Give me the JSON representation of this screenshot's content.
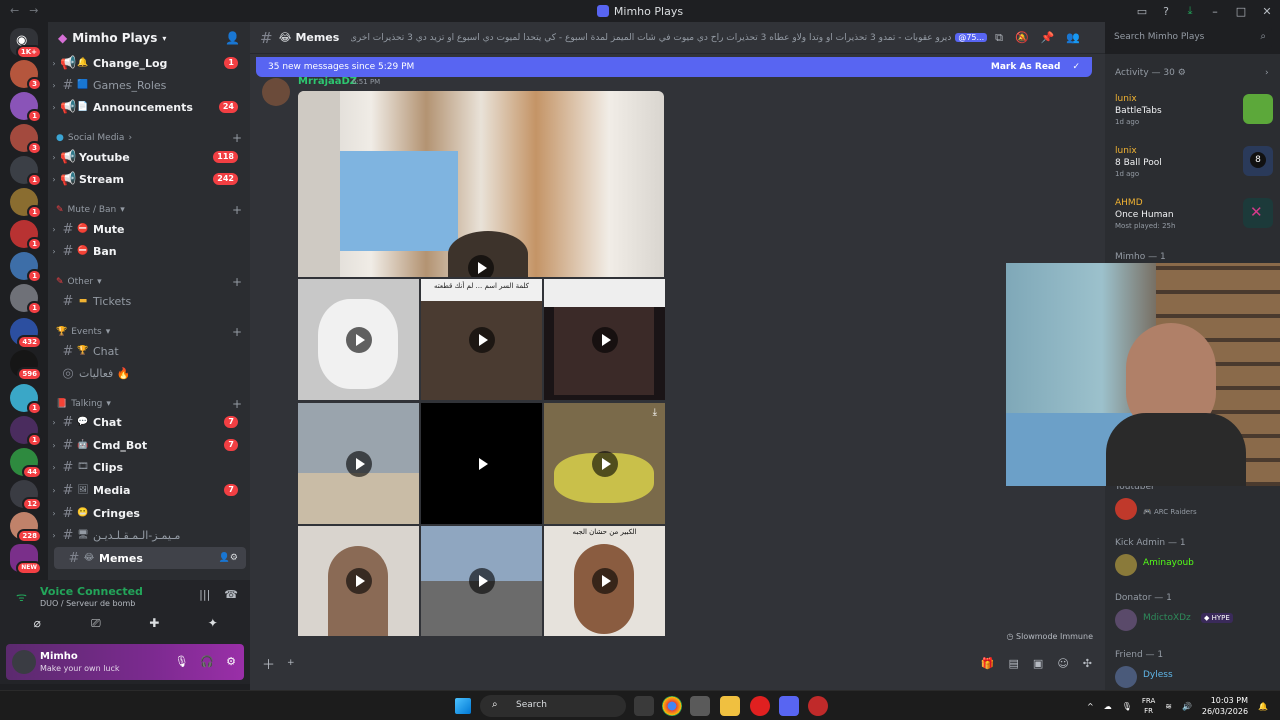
{
  "window": {
    "title": "Mimho Plays"
  },
  "server": {
    "name": "Mimho Plays",
    "channels_top": [
      {
        "name": "Change_Log",
        "emoji": "🔔",
        "count": "1",
        "bold": true
      },
      {
        "name": "Games_Roles",
        "emoji": "🟦",
        "count": "",
        "bold": false
      },
      {
        "name": "Announcements",
        "emoji": "📄",
        "count": "24",
        "bold": true
      }
    ],
    "categories": {
      "social": "Social Media",
      "mute": "Mute / Ban",
      "other": "Other",
      "events": "Events",
      "talking": "Talking"
    },
    "social_channels": [
      {
        "name": "Youtube",
        "count": "118"
      },
      {
        "name": "Stream",
        "count": "242"
      }
    ],
    "mute_channels": [
      {
        "name": "Mute"
      },
      {
        "name": "Ban"
      }
    ],
    "other_channels": [
      {
        "name": "Tickets"
      }
    ],
    "event_channels": [
      {
        "name": "Chat"
      },
      {
        "name": "فعاليات 🔥"
      }
    ],
    "talking_channels": [
      {
        "name": "Chat",
        "count": "7"
      },
      {
        "name": "Cmd_Bot",
        "count": "7"
      },
      {
        "name": "Clips",
        "count": ""
      },
      {
        "name": "Media",
        "count": "7"
      },
      {
        "name": "Cringes",
        "count": ""
      },
      {
        "name": "مـيمـز-الـمـقـلـديـن",
        "count": ""
      },
      {
        "name": "Memes",
        "count": ""
      }
    ]
  },
  "voice": {
    "title": "Voice Connected",
    "subtitle": "DUO / Serveur de bomb"
  },
  "user": {
    "name": "Mimho",
    "status": "Make your own luck"
  },
  "chat": {
    "channel": "Memes",
    "topic": "ديرو عقوبات - تمدو 3 تحذيرات او وتدا ولاو عطاه 3 تحذيرات راح دي ميوت في شات الميمز لمدة اسبوع - كي يتحدا لميوت دي اسبوع او تزيد دي 3 تحذيرات أخرى راح دي ميوت دي شهر من شات ليميز",
    "mention": "@75...",
    "new_messages": "35 new messages since 5:29 PM",
    "mark_read": "Mark As Read",
    "message_user": "MrrajaaDZ",
    "message_time": "6:51 PM",
    "slowmode": "Slowmode Immune",
    "tile_caption_1": "كلمة السر اسم ... لم أنك قطعته",
    "tile_caption_2": "الكبير من حشان الجبه"
  },
  "search": {
    "placeholder": "Search Mimho Plays"
  },
  "activity": {
    "title": "Activity — 30",
    "items": [
      {
        "user": "lunix",
        "game": "BattleTabs",
        "ago": "1d ago"
      },
      {
        "user": "lunix",
        "game": "8 Ball Pool",
        "ago": "1d ago"
      },
      {
        "user": "AHMD",
        "game": "Once Human",
        "ago": "Most played: 25h"
      }
    ]
  },
  "members": {
    "mimho_section": "Mimho — 1",
    "youtuber_section": "Youtuber",
    "youtuber_sub": "ARC Raiders",
    "kick_section": "Kick Admin — 1",
    "kick_member": "Aminayoub",
    "donator_section": "Donator — 1",
    "donator_member": "MdictoXDz",
    "donator_tag": "HYPE",
    "friend_section": "Friend — 1",
    "friend_member": "Dyless"
  },
  "taskbar": {
    "search": "Search",
    "lang1": "FRA",
    "lang2": "FR",
    "time": "10:03 PM",
    "date": "26/03/2026"
  },
  "rail_badges": [
    "1K+",
    "3",
    "1",
    "3",
    "1",
    "1",
    "1",
    "1",
    "1",
    "432",
    "596",
    "1",
    "1",
    "44",
    "12",
    "228",
    "NEW"
  ]
}
